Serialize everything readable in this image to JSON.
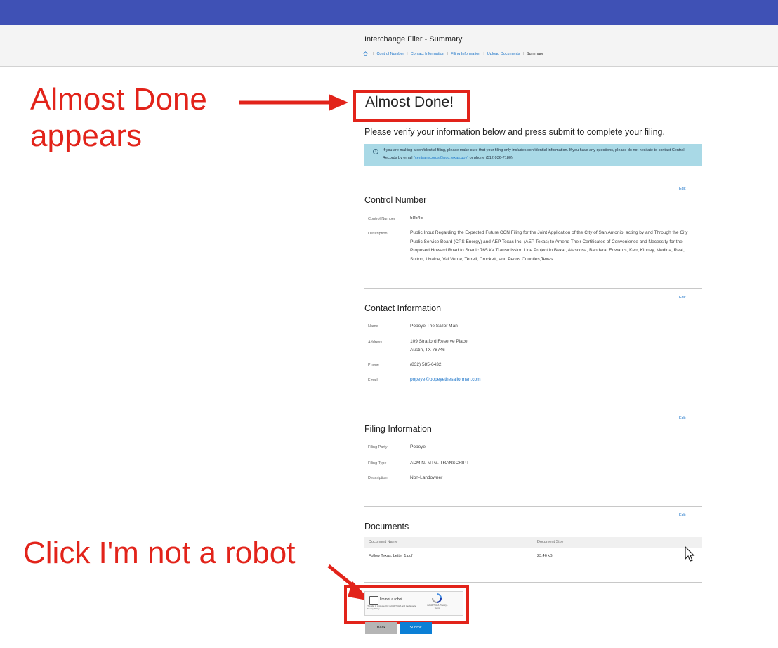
{
  "header": {
    "app_title": "Interchange Filer - Summary",
    "breadcrumb": [
      "Control Number",
      "Contact Information",
      "Filing Information",
      "Upload Documents"
    ],
    "breadcrumb_current": "Summary"
  },
  "annotations": {
    "almost_done": "Almost Done appears",
    "robot": "Click I'm not a robot"
  },
  "page": {
    "heading": "Almost Done!",
    "intro": "Please verify your information below and press submit to complete your filing."
  },
  "notice": {
    "text": "If you are making a confidential filing, please make sure that your filing only includes confidential information. If you have any questions, please do not hesitate to contact Central Records by email",
    "email": "(centralrecords@puc.texas.gov)",
    "phone": "or phone (512-936-7180)."
  },
  "edit_label": "Edit",
  "control": {
    "title": "Control Number",
    "number_label": "Control Number",
    "number": "58545",
    "description_label": "Description",
    "description": "Public Input Regarding the Expected Future CCN Filing for the Joint Application of the City of San Antonio, acting by and Through the City Public Service Board (CPS Energy) and AEP Texas Inc. (AEP Texas) to Amend Their Certificates of Convenience and Necessity for the Proposed Howard Road to Scenic 765 kV Transmission Line Project in Bexar, Atascosa, Bandera, Edwards, Kerr, Kinney, Medina, Real, Sutton, Uvalde, Val Verde, Terrell, Crockett, and Pecos Counties,Texas"
  },
  "contact": {
    "title": "Contact Information",
    "name_label": "Name",
    "name": "Popeye The Sailor Man",
    "address_label": "Address",
    "address_line1": "109 Stratford Reserve Place",
    "address_line2": "Austin, TX 78746",
    "phone_label": "Phone",
    "phone": "(832) 585-6432",
    "email_label": "Email",
    "email": "popeye@popeyethesailorman.com"
  },
  "filing": {
    "title": "Filing Information",
    "party_label": "Filing Party",
    "party": "Popeye",
    "type_label": "Filing Type",
    "type": "ADMIN. MTG. TRANSCRIPT",
    "description_label": "Description",
    "description": "Non-Landowner"
  },
  "documents": {
    "title": "Documents",
    "col_name": "Document Name",
    "col_size": "Document Size",
    "rows": [
      {
        "name": "Follow Texas, Letter 1.pdf",
        "size": "23.46 kB"
      }
    ]
  },
  "captcha": {
    "label": "I'm not a robot",
    "fine_print": "This site is protected by reCAPTCHA and the Google Privacy Policy",
    "brand": "reCAPTCHA Privacy - Terms"
  },
  "buttons": {
    "back": "Back",
    "submit": "Submit"
  },
  "colors": {
    "topbar": "#3f51b5",
    "annotation": "#e2231a",
    "notice_bg": "#a9d9e6",
    "submit_bg": "#0b7fd6"
  }
}
